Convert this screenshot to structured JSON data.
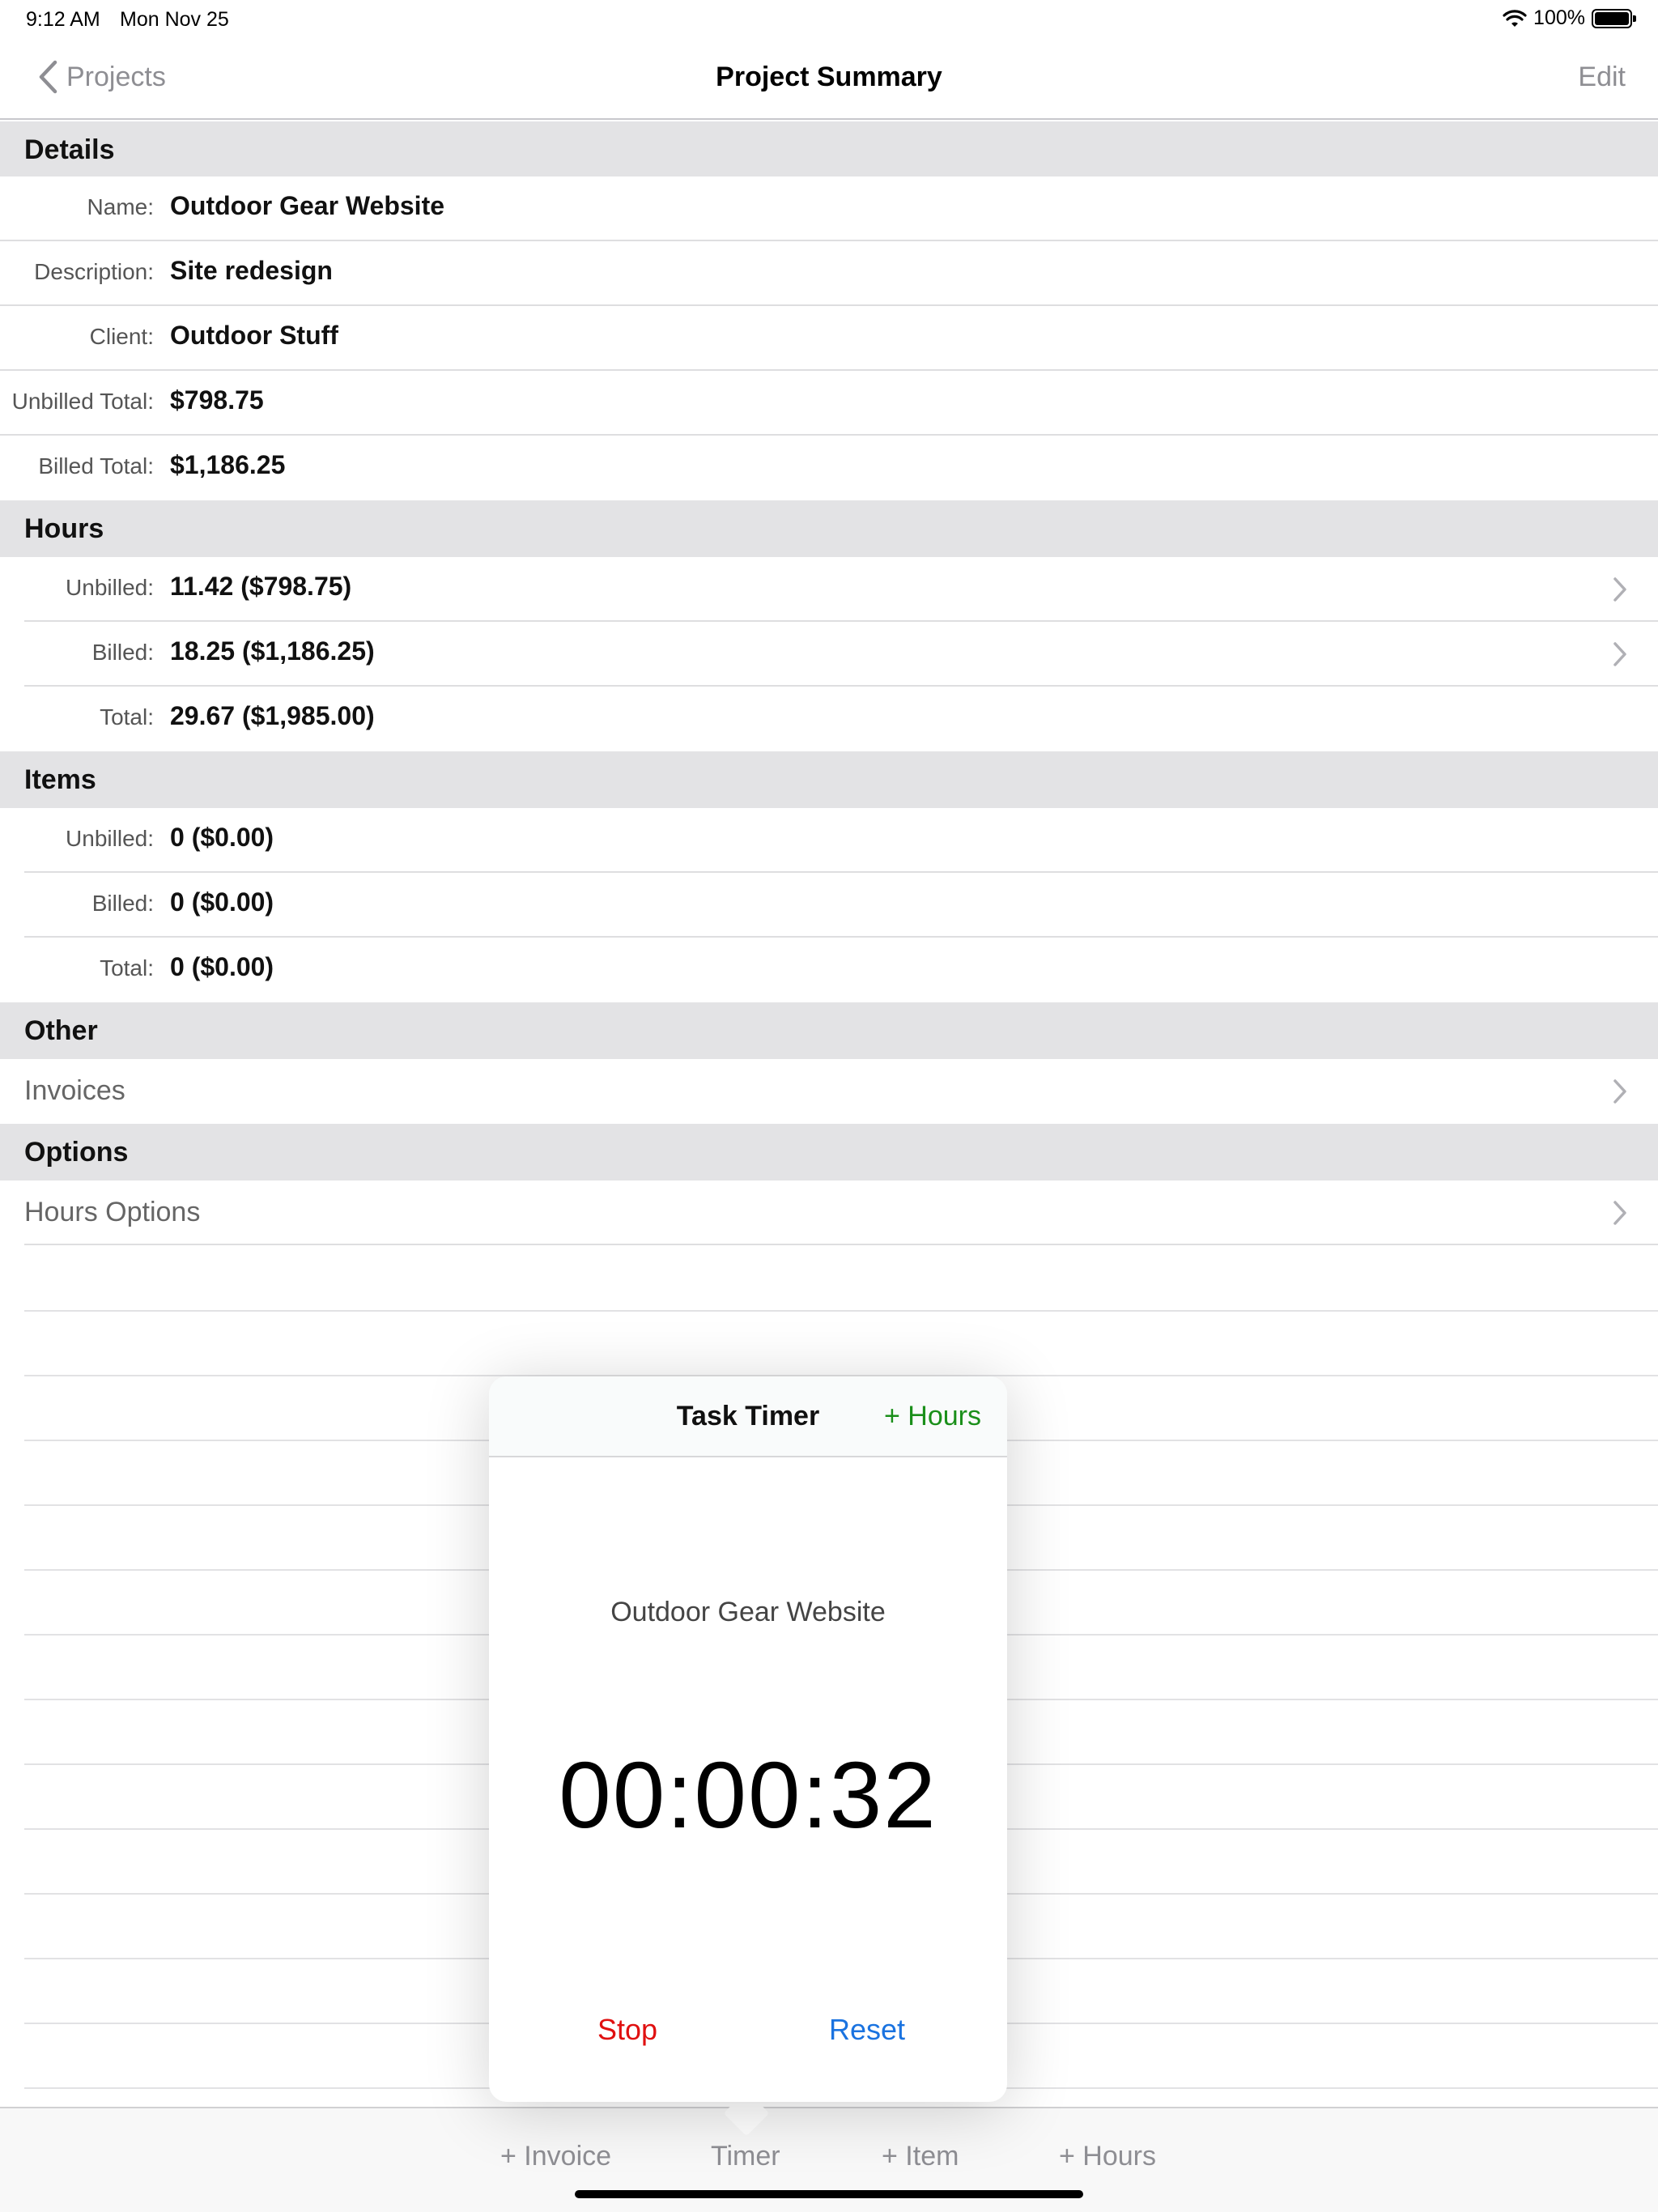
{
  "status_bar": {
    "time": "9:12 AM",
    "date": "Mon Nov 25",
    "battery": "100%"
  },
  "nav": {
    "back_label": "Projects",
    "title": "Project Summary",
    "edit_label": "Edit"
  },
  "sections": {
    "details": "Details",
    "hours": "Hours",
    "items": "Items",
    "other": "Other",
    "options": "Options"
  },
  "details": {
    "name_label": "Name:",
    "name_value": "Outdoor Gear Website",
    "description_label": "Description:",
    "description_value": "Site redesign",
    "client_label": "Client:",
    "client_value": "Outdoor Stuff",
    "unbilled_total_label": "Unbilled Total:",
    "unbilled_total_value": "$798.75",
    "billed_total_label": "Billed Total:",
    "billed_total_value": "$1,186.25"
  },
  "hours": {
    "unbilled_label": "Unbilled:",
    "unbilled_value": "11.42  ($798.75)",
    "billed_label": "Billed:",
    "billed_value": "18.25  ($1,186.25)",
    "total_label": "Total:",
    "total_value": "29.67  ($1,985.00)"
  },
  "items": {
    "unbilled_label": "Unbilled:",
    "unbilled_value": "0 ($0.00)",
    "billed_label": "Billed:",
    "billed_value": "0  ($0.00)",
    "total_label": "Total:",
    "total_value": "0  ($0.00)"
  },
  "other": {
    "invoices_label": "Invoices"
  },
  "options": {
    "hours_options_label": "Hours Options"
  },
  "timer_popover": {
    "title": "Task Timer",
    "add_hours_label": "+ Hours",
    "project_name": "Outdoor Gear Website",
    "elapsed": "00:00:32",
    "stop_label": "Stop",
    "reset_label": "Reset"
  },
  "tab_bar": {
    "invoice_label": "+ Invoice",
    "timer_label": "Timer",
    "item_label": "+ Item",
    "hours_label": "+ Hours"
  },
  "colors": {
    "stop": "#e01010",
    "reset": "#1a73e0",
    "add_hours": "#1a8f1a",
    "inactive": "#8e8e93"
  }
}
